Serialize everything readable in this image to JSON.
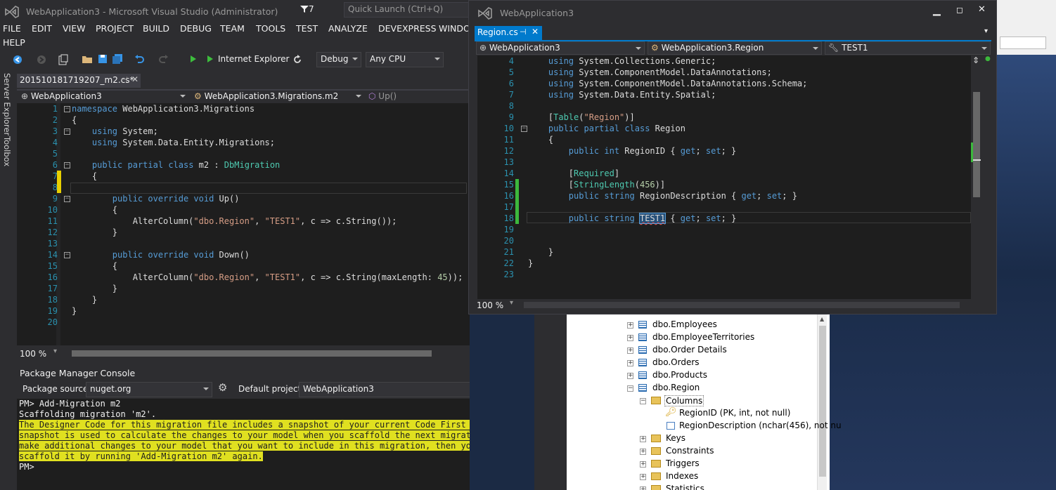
{
  "main_window": {
    "title": "WebApplication3 - Microsoft Visual Studio (Administrator)",
    "notification_count": "7",
    "quick_launch_placeholder": "Quick Launch (Ctrl+Q)",
    "menu": [
      "FILE",
      "EDIT",
      "VIEW",
      "PROJECT",
      "BUILD",
      "DEBUG",
      "TEAM",
      "TOOLS",
      "TEST",
      "ANALYZE",
      "DEVEXPRESS",
      "WINDO"
    ],
    "menu_help": "HELP",
    "toolbar": {
      "browser": "Internet Explorer",
      "config": "Debug",
      "platform": "Any CPU"
    },
    "side_tabs": [
      "Server Explorer",
      "Toolbox"
    ],
    "doc_tab": "201510181719207_m2.cs*",
    "nav": {
      "project": "WebApplication3",
      "class": "WebApplication3.Migrations.m2",
      "member": "Up()"
    },
    "code": [
      "namespace WebApplication3.Migrations",
      "{",
      "    using System;",
      "    using System.Data.Entity.Migrations;",
      "",
      "    public partial class m2 : DbMigration",
      "    {",
      "",
      "        public override void Up()",
      "        {",
      "            AlterColumn(\"dbo.Region\", \"TEST1\", c => c.String());",
      "        }",
      "",
      "        public override void Down()",
      "        {",
      "            AlterColumn(\"dbo.Region\", \"TEST1\", c => c.String(maxLength: 45));",
      "        }",
      "    }",
      "}",
      ""
    ],
    "zoom": "100 %",
    "console": {
      "title": "Package Manager Console",
      "source_label": "Package source:",
      "source_value": "nuget.org",
      "project_label": "Default project:",
      "project_value": "WebApplication3",
      "lines": [
        "PM> Add-Migration m2",
        "Scaffolding migration 'm2'."
      ],
      "highlight_lines": [
        "The Designer Code for this migration file includes a snapshot of your current Code First model. This",
        "snapshot is used to calculate the changes to your model when you scaffold the next migration. If you",
        "make additional changes to your model that you want to include in this migration, then you can re-",
        "scaffold it by running 'Add-Migration m2' again."
      ],
      "prompt": "PM>"
    }
  },
  "second_window": {
    "title": "WebApplication3",
    "doc_tab": "Region.cs",
    "nav": {
      "project": "WebApplication3",
      "class": "WebApplication3.Region",
      "member": "TEST1"
    },
    "line_numbers": [
      "4",
      "5",
      "6",
      "7",
      "8",
      "9",
      "10",
      "11",
      "12",
      "13",
      "14",
      "15",
      "16",
      "17",
      "18",
      "19",
      "20",
      "21",
      "22",
      "23"
    ],
    "code": [
      "    using System.Collections.Generic;",
      "    using System.ComponentModel.DataAnnotations;",
      "    using System.ComponentModel.DataAnnotations.Schema;",
      "    using System.Data.Entity.Spatial;",
      "",
      "    [Table(\"Region\")]",
      "    public partial class Region",
      "    {",
      "        public int RegionID { get; set; }",
      "",
      "        [Required]",
      "        [StringLength(456)]",
      "        public string RegionDescription { get; set; }",
      "",
      "        public string TEST1 { get; set; }",
      "",
      "",
      "    }",
      "}",
      ""
    ],
    "zoom": "100 %"
  },
  "object_explorer": {
    "tables": [
      "dbo.Employees",
      "dbo.EmployeeTerritories",
      "dbo.Order Details",
      "dbo.Orders",
      "dbo.Products",
      "dbo.Region"
    ],
    "columns_folder": "Columns",
    "columns": [
      "RegionID (PK, int, not null)",
      "RegionDescription (nchar(456), not nu"
    ],
    "folders": [
      "Keys",
      "Constraints",
      "Triggers",
      "Indexes",
      "Statistics"
    ]
  }
}
